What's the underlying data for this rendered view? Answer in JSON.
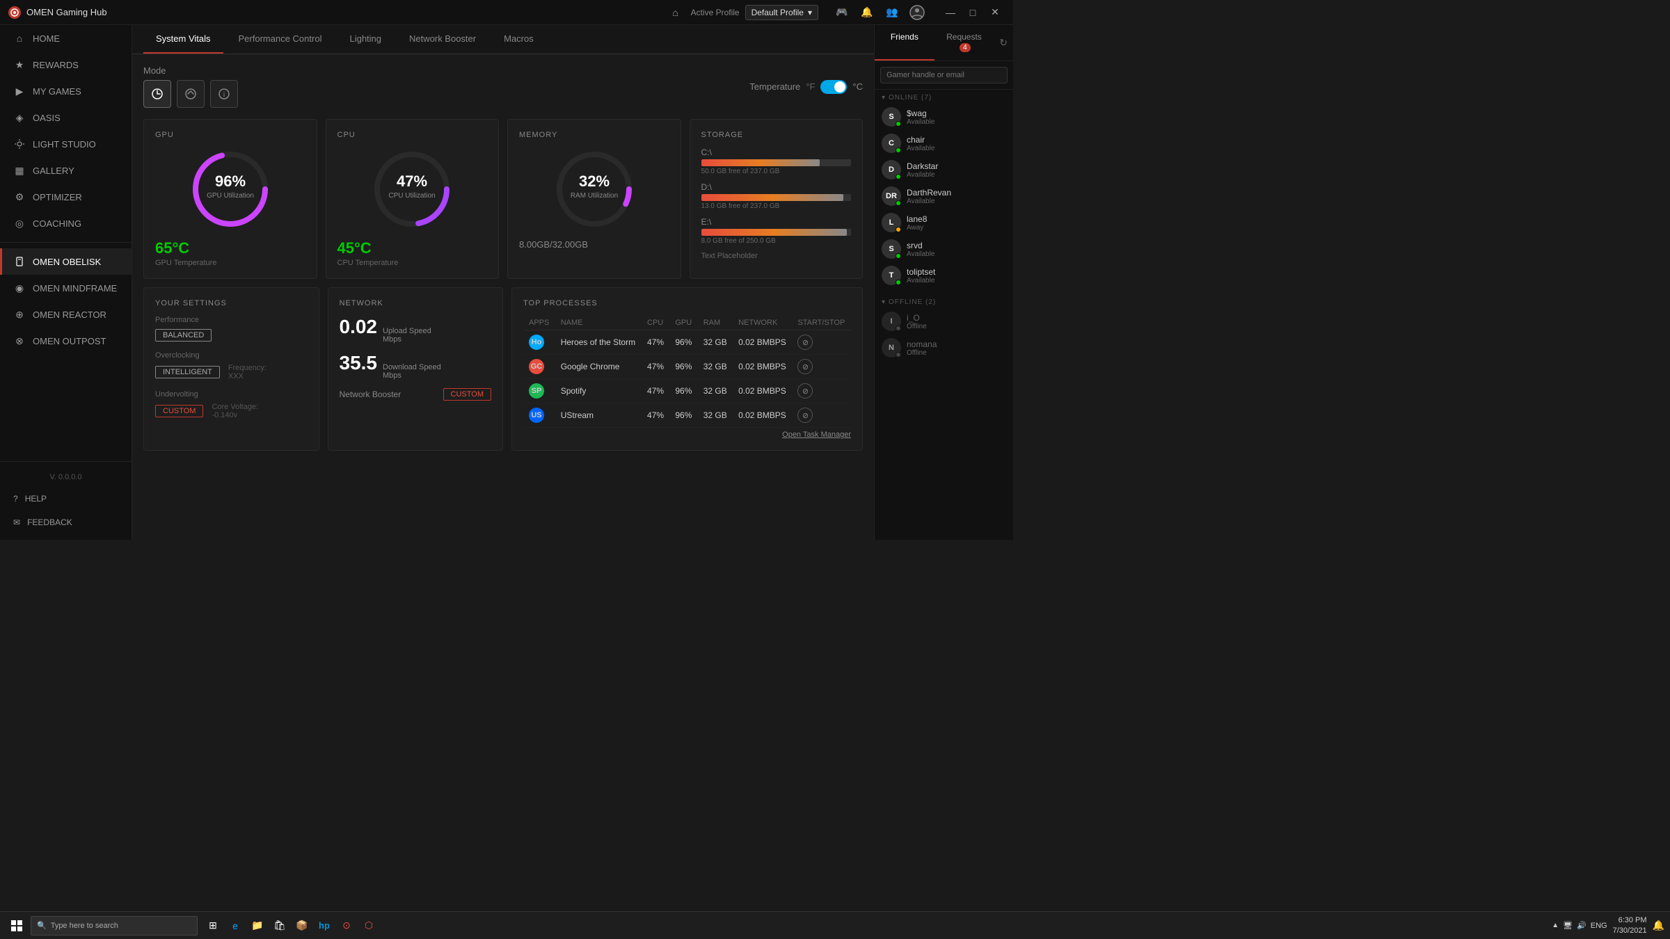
{
  "app": {
    "logo": "⊙",
    "title": "OMEN Gaming Hub"
  },
  "titlebar": {
    "active_profile_label": "Active Profile",
    "profile_name": "Default Profile",
    "home_tooltip": "Home",
    "min": "—",
    "max": "□",
    "close": "✕"
  },
  "sidebar": {
    "items": [
      {
        "id": "home",
        "label": "HOME",
        "icon": "⌂",
        "active": false
      },
      {
        "id": "rewards",
        "label": "REWARDS",
        "icon": "★",
        "active": false
      },
      {
        "id": "my-games",
        "label": "MY GAMES",
        "icon": "▶",
        "active": false
      },
      {
        "id": "oasis",
        "label": "OASIS",
        "icon": "◈",
        "active": false
      },
      {
        "id": "light-studio",
        "label": "LIGHT STUDIO",
        "icon": "💡",
        "active": false
      },
      {
        "id": "gallery",
        "label": "GALLERY",
        "icon": "🖼",
        "active": false
      },
      {
        "id": "optimizer",
        "label": "OPTIMIZER",
        "icon": "⚙",
        "active": false
      },
      {
        "id": "coaching",
        "label": "COACHING",
        "icon": "🎯",
        "active": false
      }
    ],
    "devices": [
      {
        "id": "omen-obelisk",
        "label": "OMEN OBELISK",
        "active": true
      },
      {
        "id": "omen-mindframe",
        "label": "OMEN MINDFRAME",
        "active": false
      },
      {
        "id": "omen-reactor",
        "label": "OMEN REACTOR",
        "active": false
      },
      {
        "id": "omen-outpost",
        "label": "OMEN OUTPOST",
        "active": false
      }
    ],
    "version": "V. 0.0.0.0",
    "help_label": "HELP",
    "feedback_label": "FEEDBACK"
  },
  "tabs": [
    {
      "id": "system-vitals",
      "label": "System Vitals",
      "active": true
    },
    {
      "id": "performance-control",
      "label": "Performance Control",
      "active": false
    },
    {
      "id": "lighting",
      "label": "Lighting",
      "active": false
    },
    {
      "id": "network-booster",
      "label": "Network Booster",
      "active": false
    },
    {
      "id": "macros",
      "label": "Macros",
      "active": false
    }
  ],
  "mode": {
    "label": "Mode",
    "buttons": [
      {
        "id": "dashboard",
        "icon": "⊙",
        "active": true
      },
      {
        "id": "performance",
        "icon": "⚡",
        "active": false
      },
      {
        "id": "info",
        "icon": "ℹ",
        "active": false
      }
    ]
  },
  "temperature": {
    "label": "Temperature",
    "unit_f": "°F",
    "unit_c": "°C",
    "selected": "celsius"
  },
  "gpu": {
    "title": "GPU",
    "utilization_pct": 96,
    "utilization_label": "GPU Utilization",
    "temp_value": "65°C",
    "temp_label": "GPU Temperature"
  },
  "cpu": {
    "title": "CPU",
    "utilization_pct": 47,
    "utilization_label": "CPU Utilization",
    "temp_value": "45°C",
    "temp_label": "CPU Temperature"
  },
  "memory": {
    "title": "MEMORY",
    "utilization_pct": 32,
    "utilization_label": "RAM Utilization",
    "info": "8.00GB/32.00GB"
  },
  "storage": {
    "title": "STORAGE",
    "placeholder": "Text Placeholder",
    "drives": [
      {
        "label": "C:\\",
        "free": "50.0 GB free of 237.0 GB",
        "used_pct": 79,
        "color1": "#e74c3c",
        "color2": "#e67e22"
      },
      {
        "label": "D:\\",
        "free": "13.0 GB free of 237.0 GB",
        "used_pct": 95,
        "color1": "#e74c3c",
        "color2": "#e67e22"
      },
      {
        "label": "E:\\",
        "free": "8.0 GB free of 250.0 GB",
        "used_pct": 97,
        "color1": "#e74c3c",
        "color2": "#e67e22"
      }
    ]
  },
  "your_settings": {
    "title": "YOUR SETTINGS",
    "performance_label": "Performance",
    "performance_value": "BALANCED",
    "overclocking_label": "Overclocking",
    "overclocking_value": "INTELLIGENT",
    "frequency_label": "Frequency:",
    "frequency_value": "XXX",
    "undervolting_label": "Undervolting",
    "undervolting_value": "CUSTOM",
    "core_voltage_label": "Core Voltage:",
    "core_voltage_value": "-0.140v"
  },
  "network": {
    "title": "NETWORK",
    "upload_speed": "0.02",
    "upload_label": "Upload Speed",
    "upload_unit": "Mbps",
    "download_speed": "35.5",
    "download_label": "Download Speed",
    "download_unit": "Mbps",
    "booster_label": "Network Booster",
    "booster_value": "CUSTOM"
  },
  "top_processes": {
    "title": "TOP PROCESSES",
    "columns": [
      "APPS",
      "NAME",
      "CPU",
      "GPU",
      "RAM",
      "NETWORK",
      "START/STOP"
    ],
    "rows": [
      {
        "app": "HotS",
        "name": "Heroes of the Storm",
        "cpu": "47%",
        "gpu": "96%",
        "ram": "32 GB",
        "network": "0.02 BMBPS",
        "color": "#00aaff"
      },
      {
        "app": "GC",
        "name": "Google Chrome",
        "cpu": "47%",
        "gpu": "96%",
        "ram": "32 GB",
        "network": "0.02 BMBPS",
        "color": "#e74c3c"
      },
      {
        "app": "SP",
        "name": "Spotify",
        "cpu": "47%",
        "gpu": "96%",
        "ram": "32 GB",
        "network": "0.02 BMBPS",
        "color": "#1db954"
      },
      {
        "app": "US",
        "name": "UStream",
        "cpu": "47%",
        "gpu": "96%",
        "ram": "32 GB",
        "network": "0.02 BMBPS",
        "color": "#0066ff"
      }
    ],
    "open_task_manager": "Open Task Manager"
  },
  "friends": {
    "tabs": [
      {
        "label": "Friends",
        "active": true
      },
      {
        "label": "Requests",
        "badge": "4",
        "active": false
      }
    ],
    "search_placeholder": "Gamer handle or email",
    "online_label": "ONLINE (7)",
    "offline_label": "OFFLINE (2)",
    "online_friends": [
      {
        "name": "$wag",
        "status": "Available",
        "dot": "online",
        "initial": "S"
      },
      {
        "name": "chair",
        "status": "Available",
        "dot": "online",
        "initial": "C"
      },
      {
        "name": "Darkstar",
        "status": "Available",
        "dot": "online",
        "initial": "D"
      },
      {
        "name": "DarthRevan",
        "status": "Available",
        "dot": "online",
        "initial": "DR"
      },
      {
        "name": "lane8",
        "status": "Away",
        "dot": "away",
        "initial": "L"
      },
      {
        "name": "srvd",
        "status": "Available",
        "dot": "online",
        "initial": "S"
      },
      {
        "name": "toliptset",
        "status": "Available",
        "dot": "online",
        "initial": "T"
      }
    ],
    "offline_friends": [
      {
        "name": "i_O",
        "status": "Offline",
        "dot": "offline",
        "initial": "I"
      },
      {
        "name": "nomana",
        "status": "Offline",
        "dot": "offline",
        "initial": "N"
      }
    ]
  },
  "taskbar": {
    "search_placeholder": "Type here to search",
    "time": "6:30 PM",
    "date": "7/30/2021"
  }
}
